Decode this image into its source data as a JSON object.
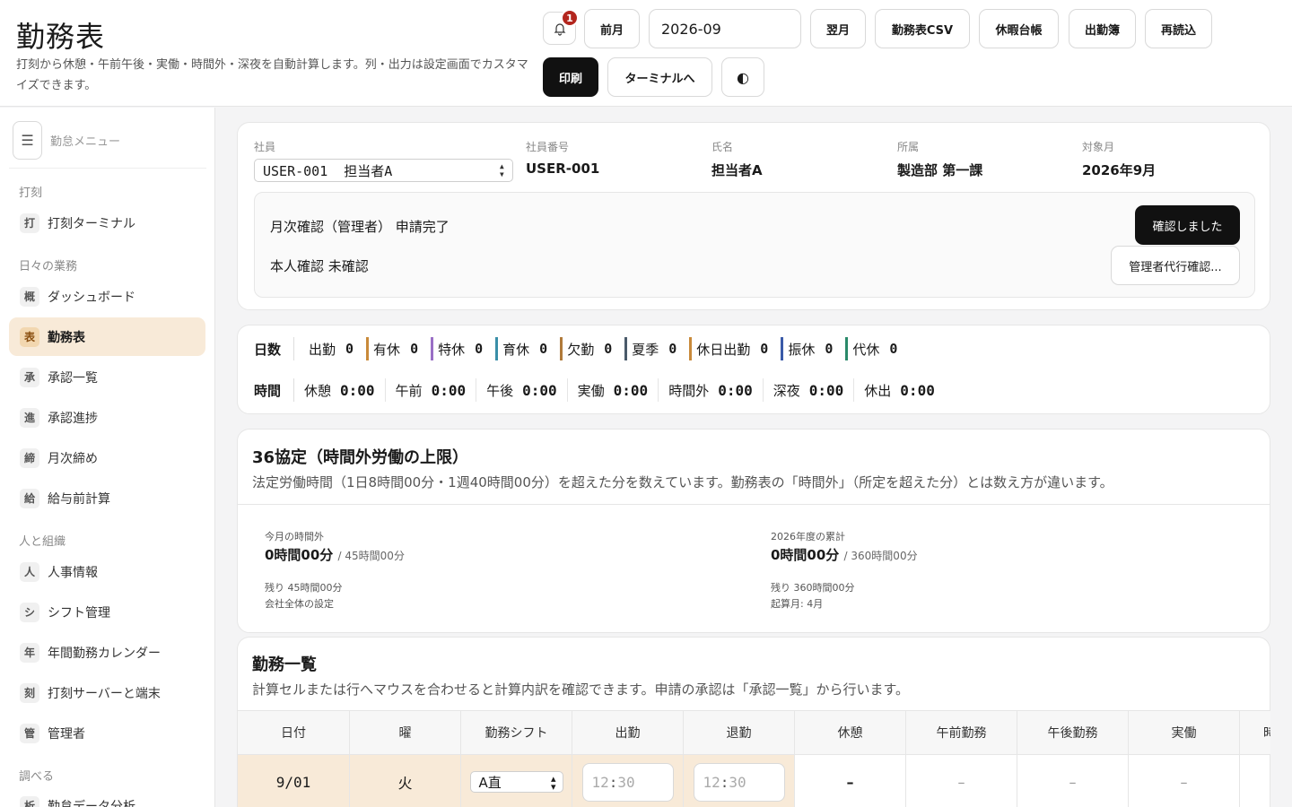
{
  "header": {
    "title": "勤務表",
    "description": "打刻から休憩・午前午後・実働・時間外・深夜を自動計算します。列・出力は設定画面でカスタマイズできます。",
    "notification_count": "1",
    "prev_month": "前月",
    "month_value": "2026-09",
    "next_month": "翌月",
    "csv": "勤務表CSV",
    "leave_ledger": "休暇台帳",
    "attendance_book": "出勤簿",
    "reload": "再読込",
    "print": "印刷",
    "to_terminal": "ターミナルへ",
    "theme_icon": "◐"
  },
  "sidebar": {
    "menu_title": "勤怠メニュー",
    "sections": [
      "打刻",
      "日々の業務",
      "人と組織",
      "調べる"
    ],
    "items": [
      {
        "chip": "打",
        "label": "打刻ターミナル"
      },
      {
        "chip": "概",
        "label": "ダッシュボード"
      },
      {
        "chip": "表",
        "label": "勤務表"
      },
      {
        "chip": "承",
        "label": "承認一覧"
      },
      {
        "chip": "進",
        "label": "承認進捗"
      },
      {
        "chip": "締",
        "label": "月次締め"
      },
      {
        "chip": "給",
        "label": "給与前計算"
      },
      {
        "chip": "人",
        "label": "人事情報"
      },
      {
        "chip": "シ",
        "label": "シフト管理"
      },
      {
        "chip": "年",
        "label": "年間勤務カレンダー"
      },
      {
        "chip": "刻",
        "label": "打刻サーバーと端末"
      },
      {
        "chip": "管",
        "label": "管理者"
      },
      {
        "chip": "析",
        "label": "勤怠データ分析"
      }
    ]
  },
  "employee": {
    "labels": {
      "employee": "社員",
      "number": "社員番号",
      "name": "氏名",
      "dept": "所属",
      "month": "対象月"
    },
    "selected": "USER-001  担当者A",
    "number": "USER-001",
    "name": "担当者A",
    "dept": "製造部 第一課",
    "month": "2026年9月",
    "confirm_status": "月次確認（管理者） 申請完了",
    "self_status": "本人確認 未確認",
    "confirmed_button": "確認しました",
    "proxy_button": "管理者代行確認..."
  },
  "summary": {
    "days_label": "日数",
    "time_label": "時間",
    "days": [
      {
        "label": "出勤",
        "value": "0",
        "color": ""
      },
      {
        "label": "有休",
        "value": "0",
        "color": "#c98a3a"
      },
      {
        "label": "特休",
        "value": "0",
        "color": "#9a6fc6"
      },
      {
        "label": "育休",
        "value": "0",
        "color": "#3a8fa8"
      },
      {
        "label": "欠勤",
        "value": "0",
        "color": "#b07a3a"
      },
      {
        "label": "夏季",
        "value": "0",
        "color": "#4a5a6a"
      },
      {
        "label": "休日出勤",
        "value": "0",
        "color": "#c98a3a"
      },
      {
        "label": "振休",
        "value": "0",
        "color": "#3a5aa8"
      },
      {
        "label": "代休",
        "value": "0",
        "color": "#2a8a6a"
      }
    ],
    "times": [
      {
        "label": "休憩",
        "value": "0:00"
      },
      {
        "label": "午前",
        "value": "0:00"
      },
      {
        "label": "午後",
        "value": "0:00"
      },
      {
        "label": "実働",
        "value": "0:00"
      },
      {
        "label": "時間外",
        "value": "0:00"
      },
      {
        "label": "深夜",
        "value": "0:00"
      },
      {
        "label": "休出",
        "value": "0:00"
      }
    ]
  },
  "agreement": {
    "title": "36協定（時間外労働の上限）",
    "desc": "法定労働時間（1日8時間00分・1週40時間00分）を超えた分を数えています。勤務表の「時間外」（所定を超えた分）とは数え方が違います。",
    "month_label": "今月の時間外",
    "month_value": "0時間00分",
    "month_limit": "/ 45時間00分",
    "month_remain": "残り 45時間00分",
    "month_note": "会社全体の設定",
    "year_label": "2026年度の累計",
    "year_value": "0時間00分",
    "year_limit": "/ 360時間00分",
    "year_remain": "残り 360時間00分",
    "year_note": "起算月: 4月"
  },
  "worklist": {
    "title": "勤務一覧",
    "desc": "計算セルまたは行へマウスを合わせると計算内訳を確認できます。申請の承認は「承認一覧」から行います。",
    "columns": [
      "日付",
      "曜",
      "勤務シフト",
      "出勤",
      "退勤",
      "休憩",
      "午前勤務",
      "午後勤務",
      "実働",
      "時"
    ],
    "row": {
      "date": "9/01",
      "weekday": "火",
      "shift": "A直",
      "in_h": "12",
      "in_m": "30",
      "out_h": "12",
      "out_m": "30",
      "break": "–",
      "am": "–",
      "pm": "–",
      "actual": "–"
    }
  }
}
